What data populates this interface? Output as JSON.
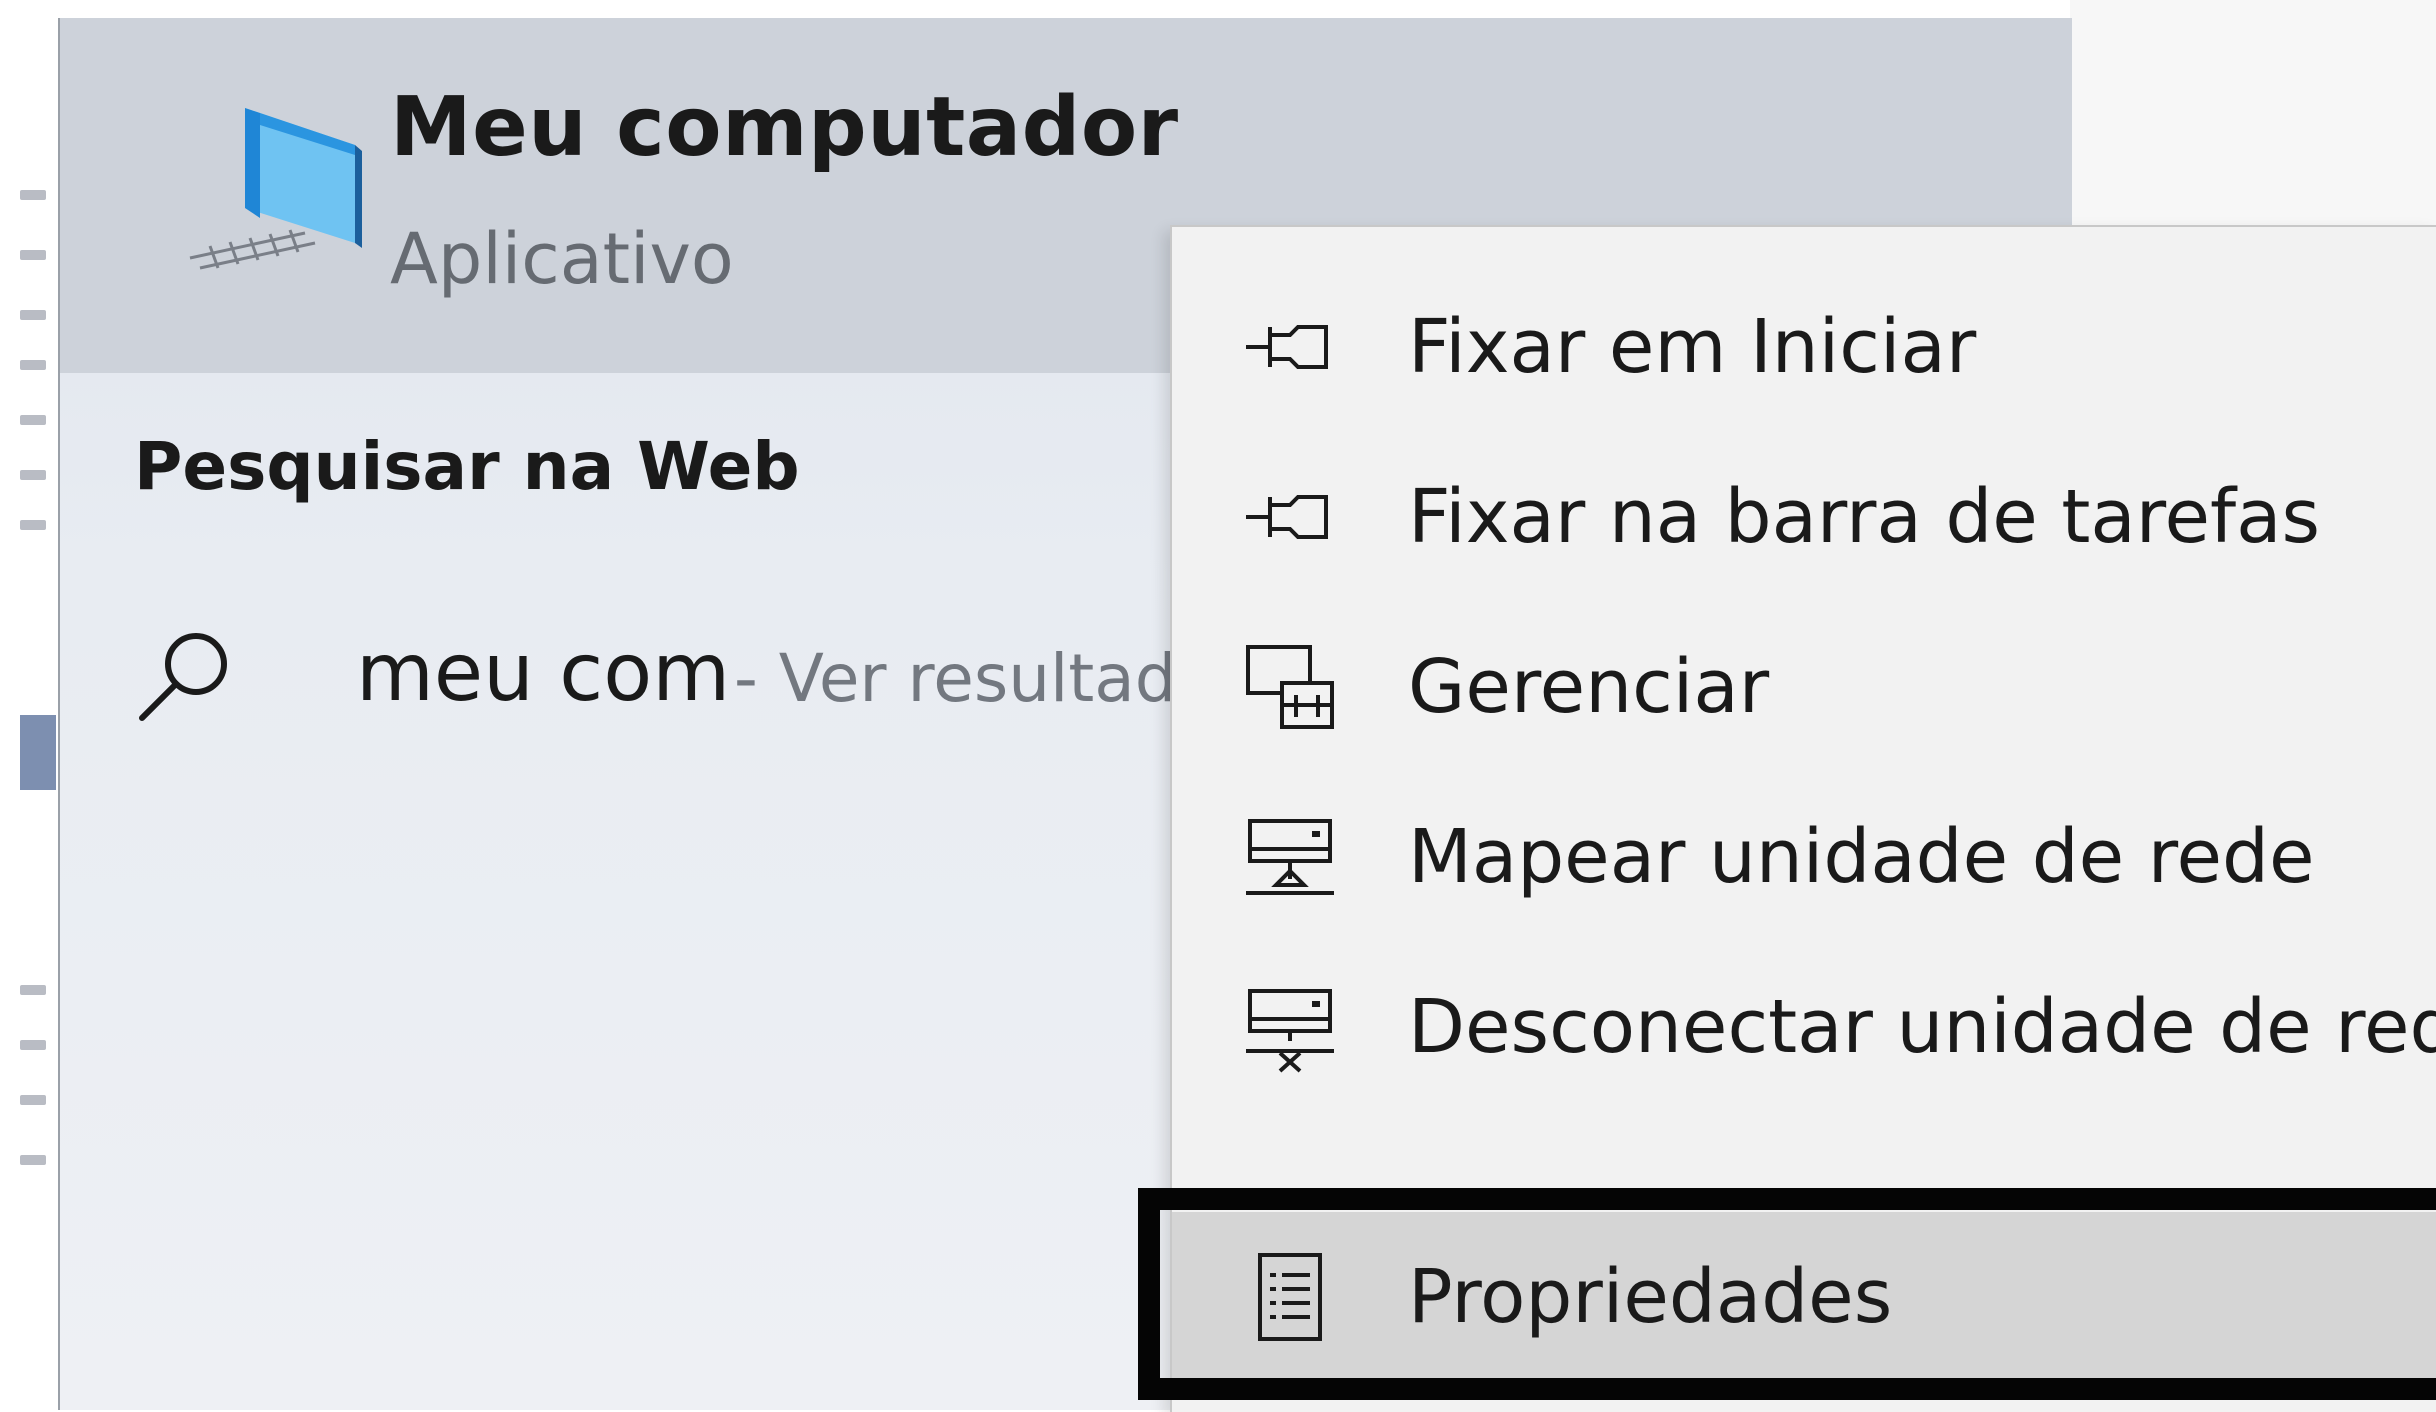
{
  "top_result": {
    "title": "Meu computador",
    "subtitle": "Aplicativo",
    "icon": "computer-icon"
  },
  "web_search": {
    "header": "Pesquisar na Web",
    "query": "meu com",
    "suffix": "- Ver resultado",
    "icon": "search-icon"
  },
  "context_menu": {
    "items": [
      {
        "label": "Fixar em Iniciar",
        "icon": "pin-icon"
      },
      {
        "label": "Fixar na barra de tarefas",
        "icon": "pin-icon"
      },
      {
        "label": "Gerenciar",
        "icon": "manage-icon"
      },
      {
        "label": "Mapear unidade de rede",
        "icon": "map-network-drive-icon"
      },
      {
        "label": "Desconectar unidade de rede",
        "icon": "disconnect-network-drive-icon"
      },
      {
        "label": "Propriedades",
        "icon": "properties-icon",
        "highlighted": true
      }
    ]
  },
  "colors": {
    "highlight_border": "#050505",
    "menu_background": "#f2f2f2",
    "top_result_background": "#cdd2da"
  }
}
